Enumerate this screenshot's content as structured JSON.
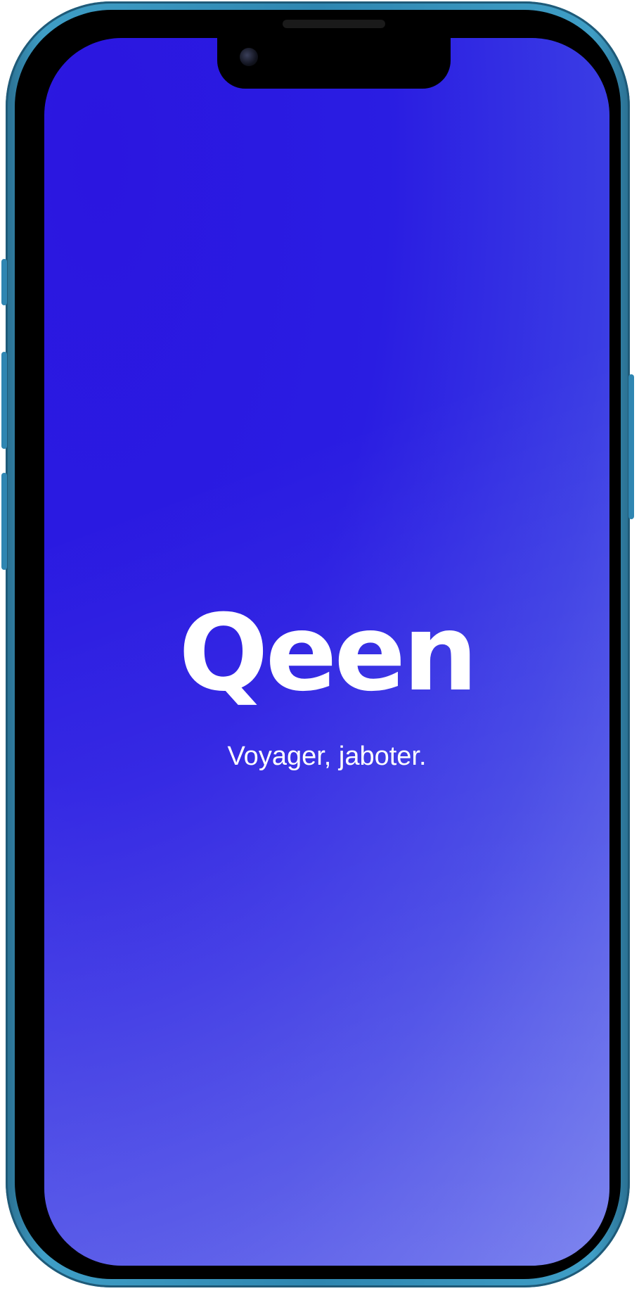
{
  "app": {
    "logo_text": "Qeen",
    "tagline": "Voyager, jaboter."
  },
  "colors": {
    "background": "#2a1de2",
    "text": "#ffffff",
    "device_frame": "#3f9ec6"
  },
  "device": {
    "icons": [
      "front-camera-icon",
      "speaker-grille-icon"
    ]
  }
}
